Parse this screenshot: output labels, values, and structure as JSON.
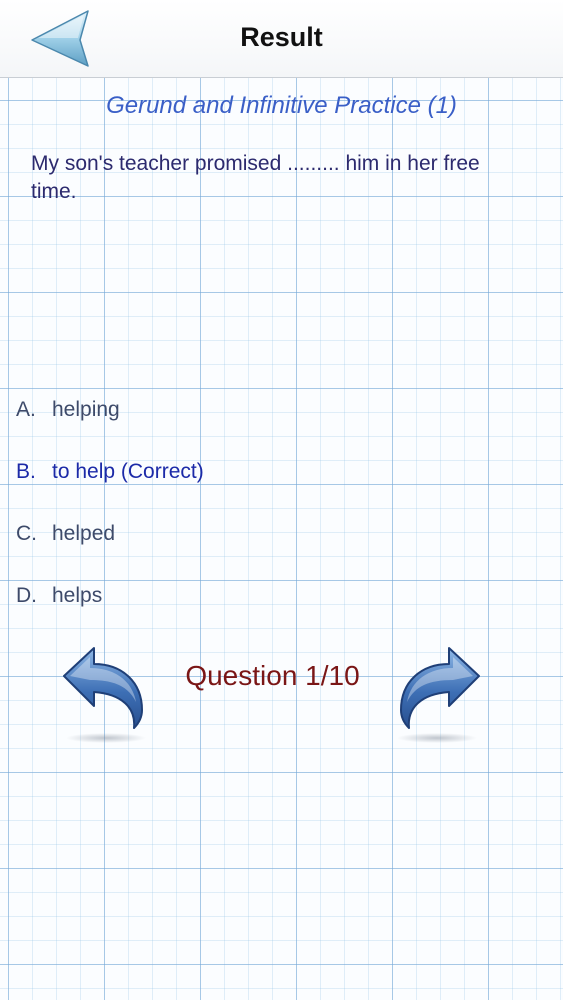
{
  "nav": {
    "title": "Result",
    "back_icon": "back-arrow-icon"
  },
  "quiz": {
    "title": "Gerund and Infinitive Practice (1)",
    "question": "My son's teacher promised ......... him in her free time.",
    "options": [
      {
        "letter": "A.",
        "text": "helping"
      },
      {
        "letter": "B.",
        "text": "to help (Correct)"
      },
      {
        "letter": "C.",
        "text": "helped"
      },
      {
        "letter": "D.",
        "text": "helps"
      }
    ],
    "counter": "Question 1/10"
  },
  "colors": {
    "accent_title": "#3a5fc7",
    "question": "#2c2a6e",
    "correct": "#1c2aa8",
    "counter": "#7a1616",
    "arrow": "#3d6fb5"
  },
  "icons": {
    "prev": "undo-arrow-icon",
    "next": "redo-arrow-icon"
  }
}
